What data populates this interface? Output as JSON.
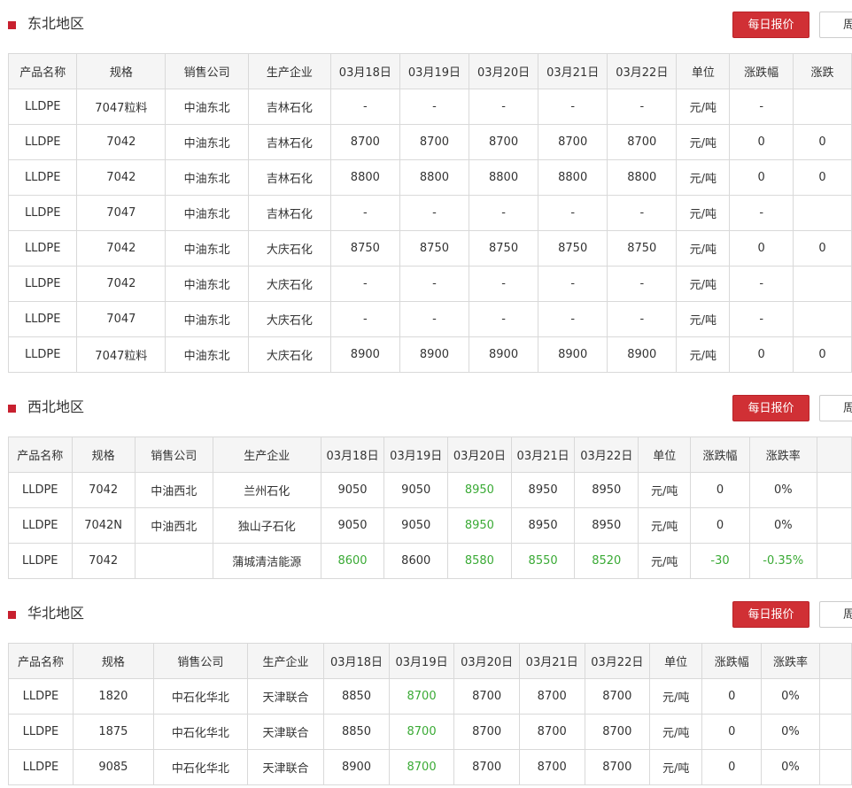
{
  "colors": {
    "accent_red": "#d03035",
    "link_blue": "#2b58c8",
    "down_green": "#3aaa35",
    "header_bg": "#f5f5f5",
    "border": "#d9d9d9"
  },
  "sections": [
    {
      "title": "东北地区",
      "daily_btn": "每日报价",
      "weekly_btn": "周",
      "headers": [
        "产品名称",
        "规格",
        "销售公司",
        "生产企业",
        "03月18日",
        "03月19日",
        "03月20日",
        "03月21日",
        "03月22日",
        "单位",
        "涨跌幅",
        "涨跌"
      ],
      "rows": [
        [
          "LLDPE",
          "7047粒料",
          "中油东北",
          "吉林石化",
          "-",
          "-",
          "-",
          "-",
          "-",
          "元/吨",
          "-",
          ""
        ],
        [
          "LLDPE",
          "7042",
          "中油东北",
          "吉林石化",
          "8700",
          "8700",
          "8700",
          "8700",
          "8700",
          "元/吨",
          "0",
          "0"
        ],
        [
          "LLDPE",
          "7042",
          "中油东北",
          "吉林石化",
          "8800",
          "8800",
          "8800",
          "8800",
          "8800",
          "元/吨",
          "0",
          "0"
        ],
        [
          "LLDPE",
          "7047",
          "中油东北",
          "吉林石化",
          "-",
          "-",
          "-",
          "-",
          "-",
          "元/吨",
          "-",
          ""
        ],
        [
          "LLDPE",
          "7042",
          "中油东北",
          "大庆石化",
          "8750",
          "8750",
          "8750",
          "8750",
          "8750",
          "元/吨",
          "0",
          "0"
        ],
        [
          "LLDPE",
          "7042",
          "中油东北",
          "大庆石化",
          "-",
          "-",
          "-",
          "-",
          "-",
          "元/吨",
          "-",
          ""
        ],
        [
          "LLDPE",
          "7047",
          "中油东北",
          "大庆石化",
          "-",
          "-",
          "-",
          "-",
          "-",
          "元/吨",
          "-",
          ""
        ],
        [
          "LLDPE",
          "7047粒料",
          "中油东北",
          "大庆石化",
          "8900",
          "8900",
          "8900",
          "8900",
          "8900",
          "元/吨",
          "0",
          "0"
        ]
      ],
      "green_cells": []
    },
    {
      "title": "西北地区",
      "daily_btn": "每日报价",
      "weekly_btn": "周",
      "headers": [
        "产品名称",
        "规格",
        "销售公司",
        "生产企业",
        "03月18日",
        "03月19日",
        "03月20日",
        "03月21日",
        "03月22日",
        "单位",
        "涨跌幅",
        "涨跌率",
        ""
      ],
      "rows": [
        [
          "LLDPE",
          "7042",
          "中油西北",
          "兰州石化",
          "9050",
          "9050",
          "8950",
          "8950",
          "8950",
          "元/吨",
          "0",
          "0%",
          ""
        ],
        [
          "LLDPE",
          "7042N",
          "中油西北",
          "独山子石化",
          "9050",
          "9050",
          "8950",
          "8950",
          "8950",
          "元/吨",
          "0",
          "0%",
          ""
        ],
        [
          "LLDPE",
          "7042",
          "",
          "蒲城清洁能源",
          "8600",
          "8600",
          "8580",
          "8550",
          "8520",
          "元/吨",
          "-30",
          "-0.35%",
          ""
        ]
      ],
      "green_cells": [
        [
          0,
          6
        ],
        [
          1,
          6
        ],
        [
          2,
          4
        ],
        [
          2,
          6
        ],
        [
          2,
          7
        ],
        [
          2,
          8
        ],
        [
          2,
          10
        ],
        [
          2,
          11
        ]
      ]
    },
    {
      "title": "华北地区",
      "daily_btn": "每日报价",
      "weekly_btn": "周",
      "headers": [
        "产品名称",
        "规格",
        "销售公司",
        "生产企业",
        "03月18日",
        "03月19日",
        "03月20日",
        "03月21日",
        "03月22日",
        "单位",
        "涨跌幅",
        "涨跌率",
        ""
      ],
      "rows": [
        [
          "LLDPE",
          "1820",
          "中石化华北",
          "天津联合",
          "8850",
          "8700",
          "8700",
          "8700",
          "8700",
          "元/吨",
          "0",
          "0%",
          ""
        ],
        [
          "LLDPE",
          "1875",
          "中石化华北",
          "天津联合",
          "8850",
          "8700",
          "8700",
          "8700",
          "8700",
          "元/吨",
          "0",
          "0%",
          ""
        ],
        [
          "LLDPE",
          "9085",
          "中石化华北",
          "天津联合",
          "8900",
          "8700",
          "8700",
          "8700",
          "8700",
          "元/吨",
          "0",
          "0%",
          ""
        ]
      ],
      "green_cells": [
        [
          0,
          5
        ],
        [
          1,
          5
        ],
        [
          2,
          5
        ]
      ]
    }
  ]
}
